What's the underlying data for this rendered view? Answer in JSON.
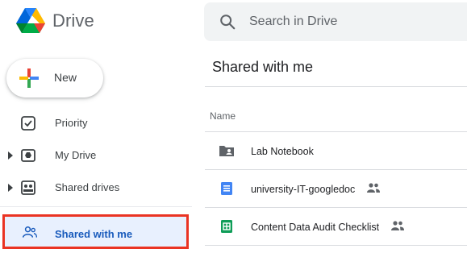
{
  "app": {
    "title": "Drive"
  },
  "search": {
    "placeholder": "Search in Drive"
  },
  "sidebar": {
    "new_label": "New",
    "items": [
      {
        "label": "Priority"
      },
      {
        "label": "My Drive"
      },
      {
        "label": "Shared drives"
      },
      {
        "label": "Shared with me"
      }
    ]
  },
  "main": {
    "title": "Shared with me",
    "column_name": "Name",
    "files": [
      {
        "name": "Lab Notebook",
        "icon": "shared-folder-icon",
        "shared": false
      },
      {
        "name": "university-IT-googledoc",
        "icon": "google-docs-icon",
        "shared": true
      },
      {
        "name": "Content Data Audit Checklist",
        "icon": "google-sheets-icon",
        "shared": true
      }
    ]
  },
  "colors": {
    "active_nav_bg": "#e8f0fe",
    "active_nav_text": "#185abc",
    "highlight_border": "#ea3323",
    "docs_blue": "#4285f4",
    "sheets_green": "#0f9d58"
  }
}
